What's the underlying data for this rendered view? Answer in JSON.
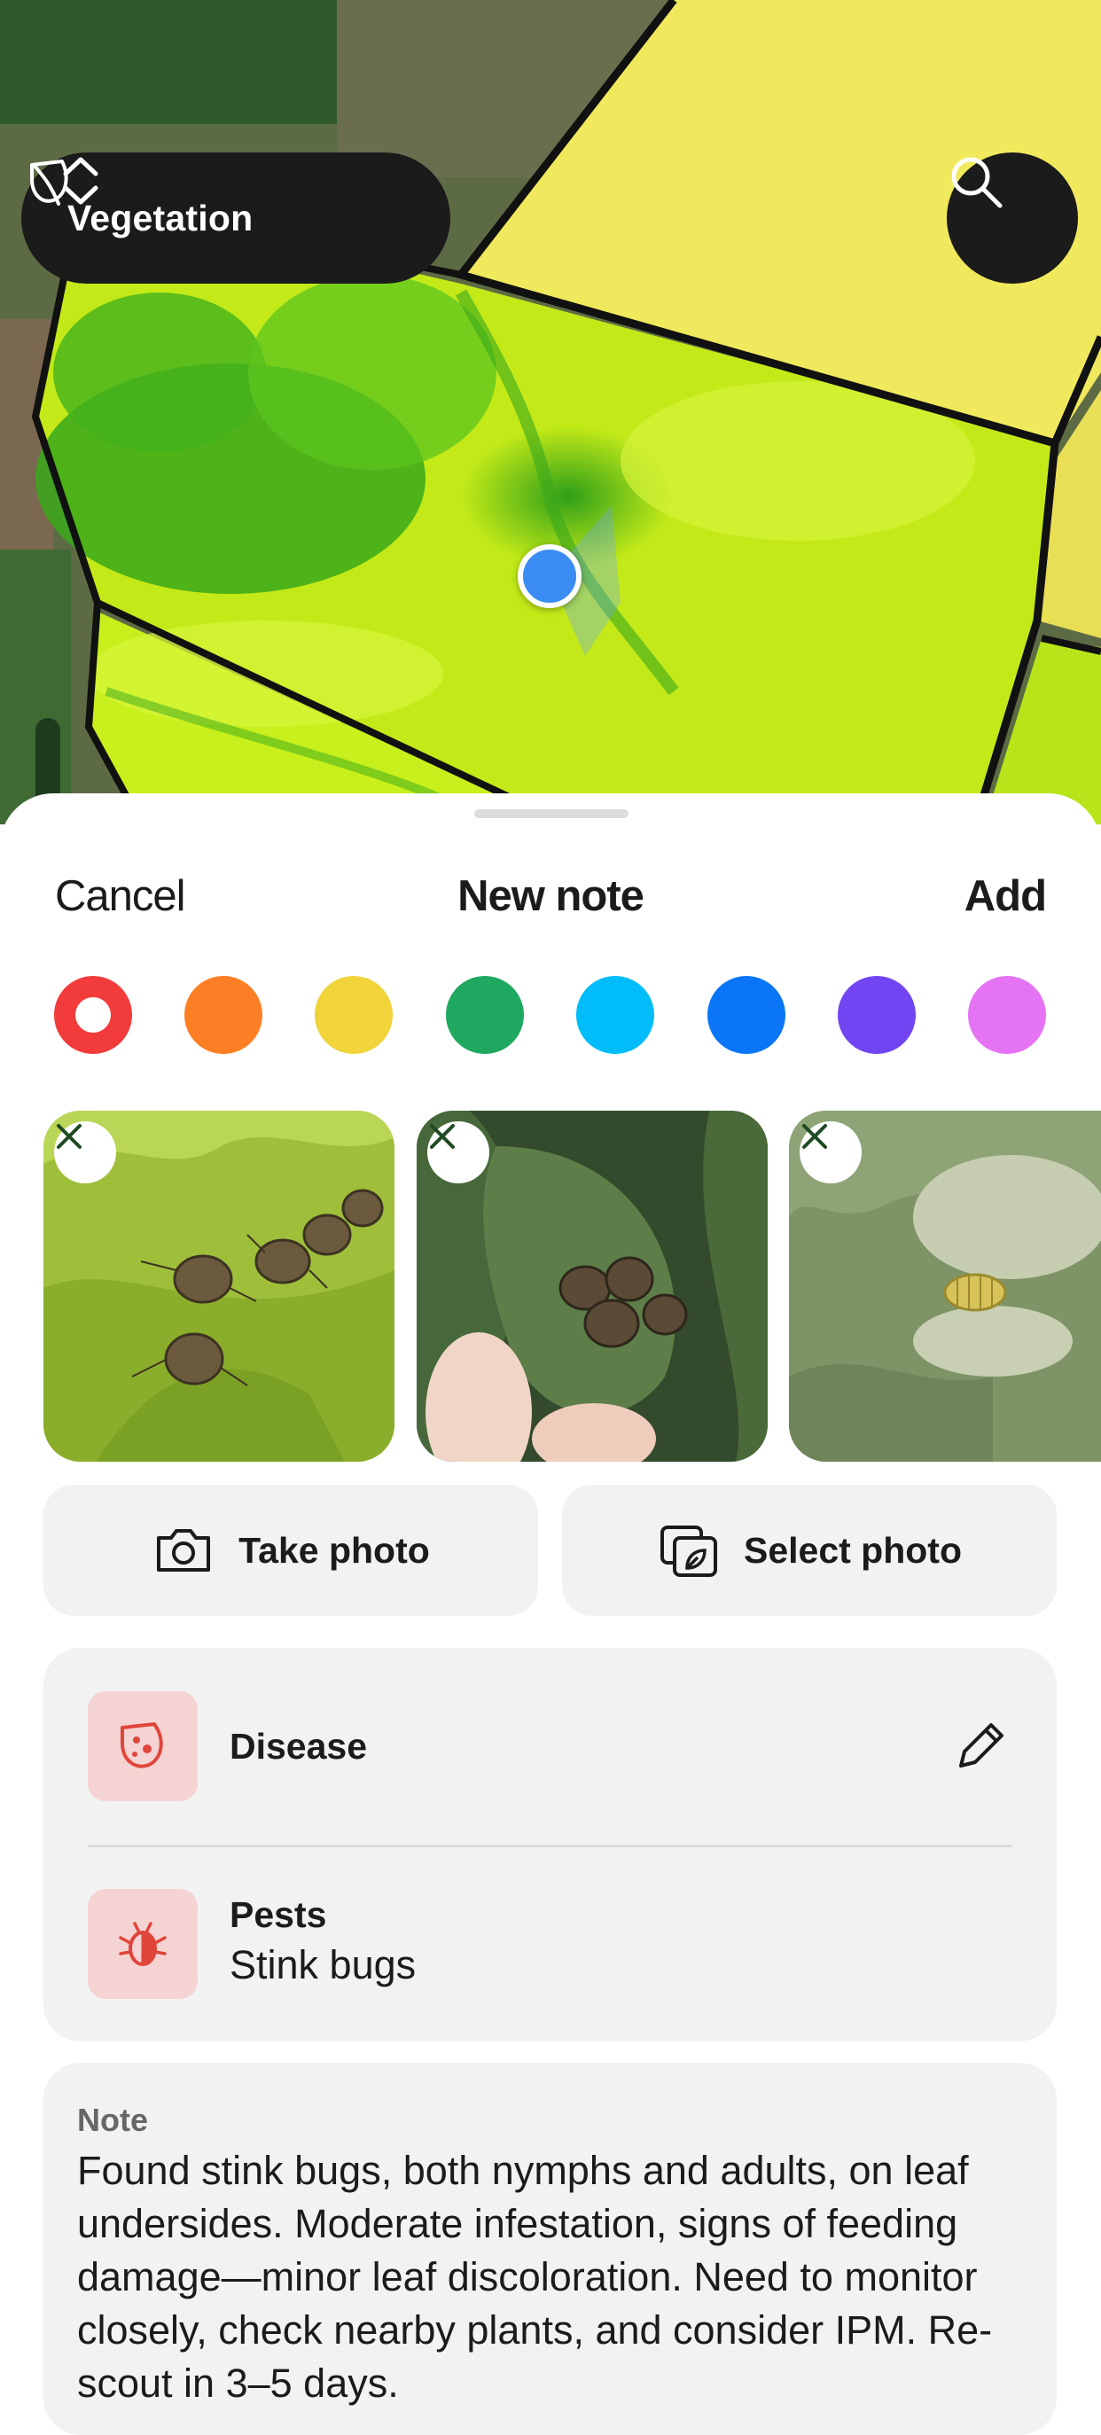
{
  "map": {
    "layer_selector": {
      "label": "Vegetation",
      "icon": "leaf-icon",
      "toggle_icon": "chevron-updown-icon"
    },
    "search": {
      "icon": "search-icon"
    },
    "location": {
      "icon": "location-dot"
    }
  },
  "sheet": {
    "cancel_label": "Cancel",
    "title": "New note",
    "add_label": "Add",
    "colors": [
      {
        "hex": "#f23b3b",
        "selected": true
      },
      {
        "hex": "#fd7f25",
        "selected": false
      },
      {
        "hex": "#f0d43a",
        "selected": false
      },
      {
        "hex": "#1fa960",
        "selected": false
      },
      {
        "hex": "#00bcf9",
        "selected": false
      },
      {
        "hex": "#0a75f6",
        "selected": false
      },
      {
        "hex": "#7145f2",
        "selected": false
      },
      {
        "hex": "#e574f4",
        "selected": false
      }
    ],
    "photos": [
      {
        "subject": "stink bugs cluster on green leaf",
        "remove_icon": "close-icon"
      },
      {
        "subject": "stink bugs on leaf held by hand",
        "remove_icon": "close-icon"
      },
      {
        "subject": "larva on damaged leaf",
        "remove_icon": "close-icon"
      }
    ],
    "take_photo_label": "Take photo",
    "select_photo_label": "Select photo",
    "tags": [
      {
        "title": "Disease",
        "subtitle": "",
        "icon": "disease-icon",
        "action_icon": "pencil-icon"
      },
      {
        "title": "Pests",
        "subtitle": "Stink bugs",
        "icon": "bug-icon"
      }
    ],
    "note": {
      "label": "Note",
      "text": "Found stink bugs, both nymphs and adults, on leaf undersides. Moderate infestation, signs of feeding damage—minor leaf discoloration. Need to monitor closely, check nearby plants, and consider IPM. Re-scout in 3–5 days."
    }
  },
  "accent": {
    "map_dark": "#1b1b1b",
    "tag_bg": "#f6d3d3",
    "tag_icon": "#e0453a"
  }
}
